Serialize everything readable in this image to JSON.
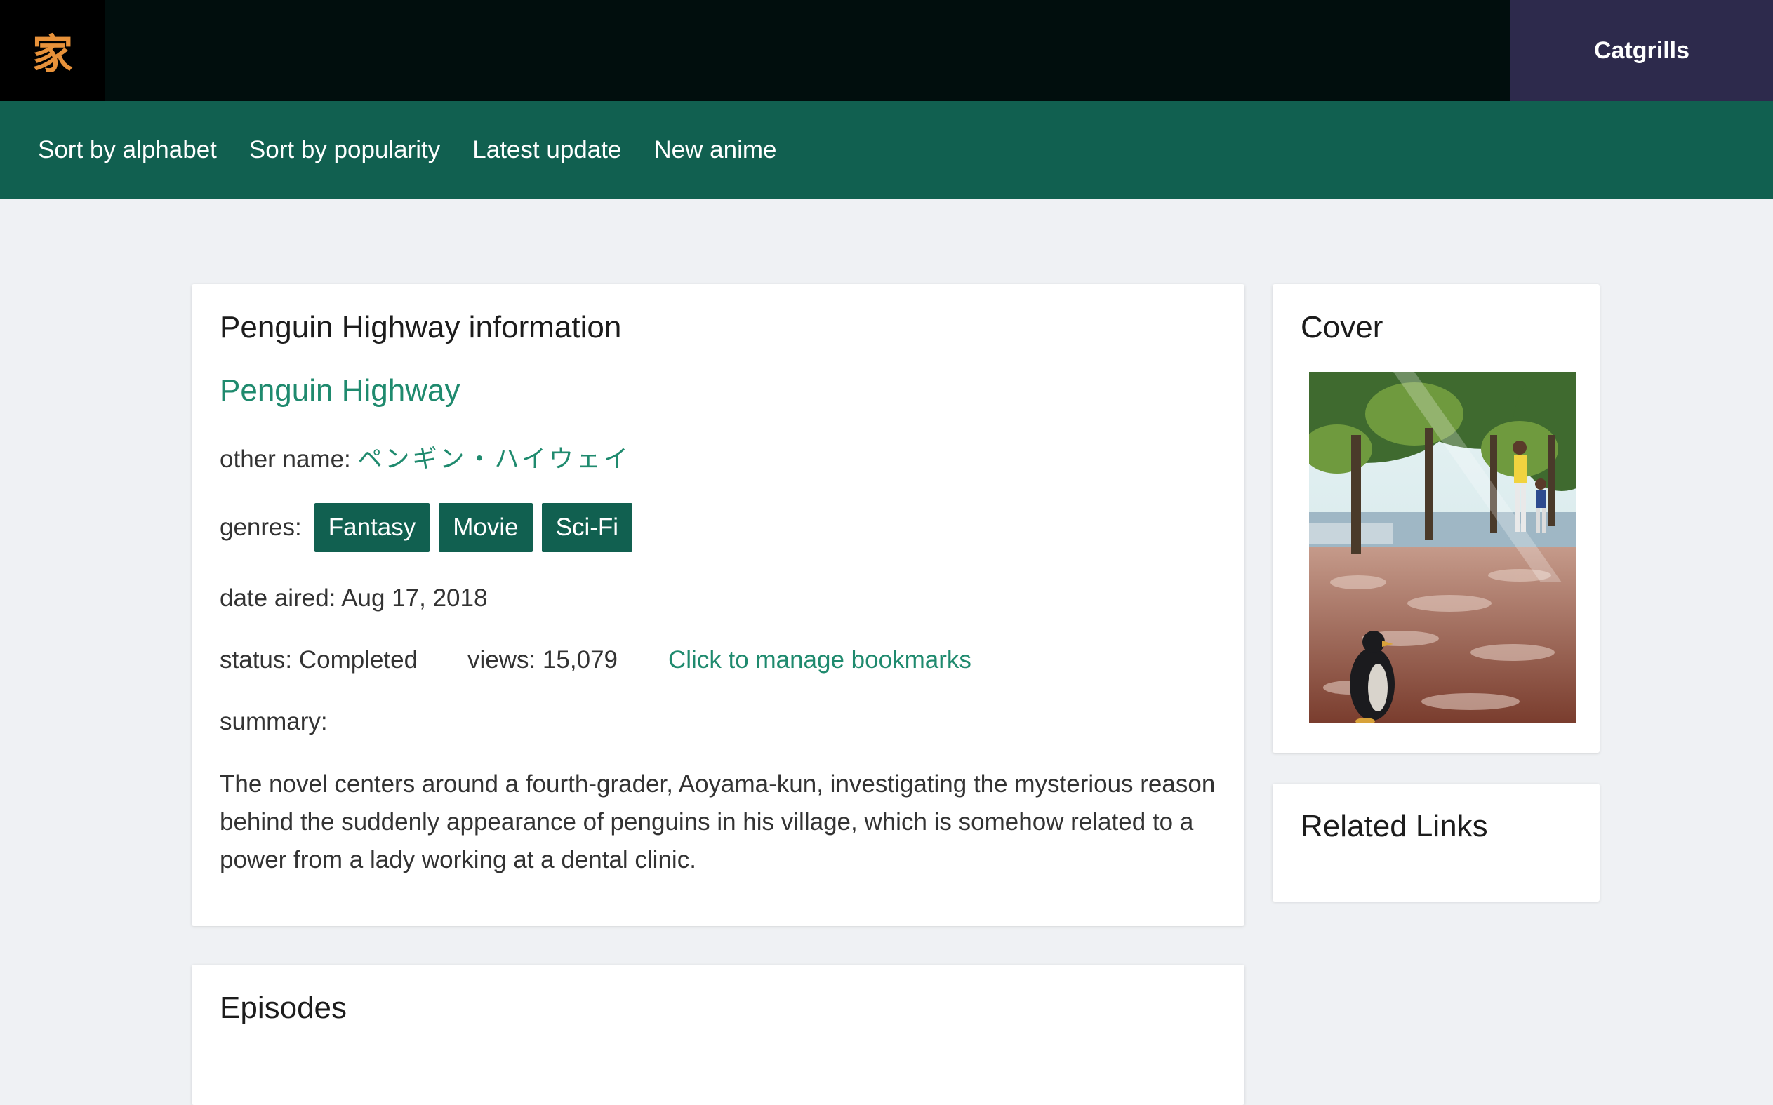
{
  "header": {
    "logo_glyph": "家",
    "user_name": "Catgrills"
  },
  "nav": [
    {
      "label": "Sort by alphabet"
    },
    {
      "label": "Sort by popularity"
    },
    {
      "label": "Latest update"
    },
    {
      "label": "New anime"
    }
  ],
  "info": {
    "heading": "Penguin Highway information",
    "title": "Penguin Highway",
    "other_name_label": "other name:",
    "other_name": "ペンギン・ハイウェイ",
    "genres_label": "genres:",
    "genres": [
      "Fantasy",
      "Movie",
      "Sci-Fi"
    ],
    "date_aired": "date aired: Aug 17, 2018",
    "status": "status: Completed",
    "views": "views: 15,079",
    "bookmark_link": "Click to manage bookmarks",
    "summary_label": "summary:",
    "summary": "The novel centers around a fourth-grader, Aoyama-kun, investigating the mysterious reason behind the suddenly appearance of penguins in his village, which is somehow related to a power from a lady working at a dental clinic."
  },
  "cover": {
    "heading": "Cover"
  },
  "related": {
    "heading": "Related Links"
  },
  "episodes": {
    "heading": "Episodes"
  },
  "colors": {
    "topbar": "#010e0d",
    "nav": "#116050",
    "user_panel": "#2d2a4c",
    "accent_text": "#1f8a6e",
    "logo": "#e8923a"
  }
}
